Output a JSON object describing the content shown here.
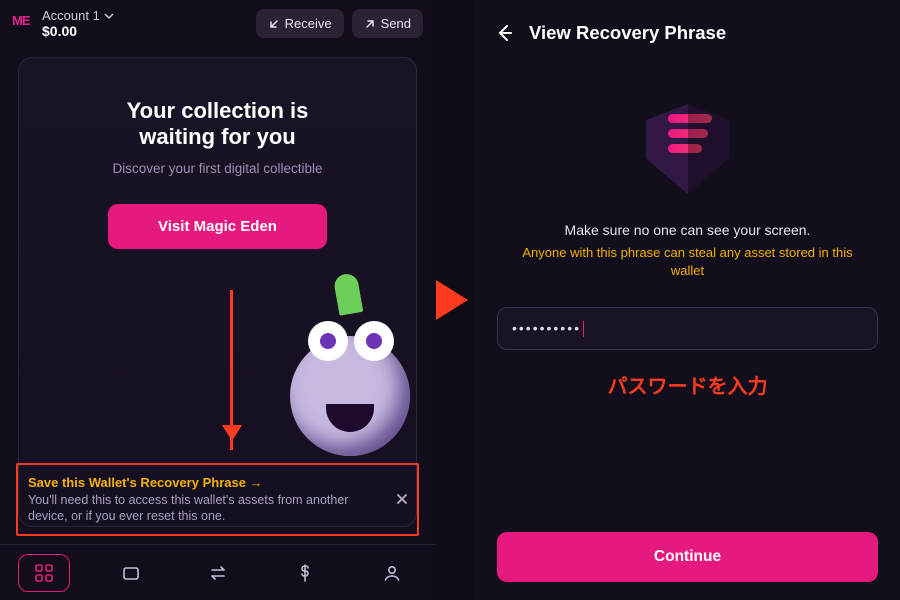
{
  "left": {
    "logo_text": "ME",
    "account_label": "Account 1",
    "balance": "$0.00",
    "receive_label": "Receive",
    "send_label": "Send",
    "hero": {
      "title_line1": "Your collection is",
      "title_line2": "waiting for you",
      "subtitle": "Discover your first digital collectible",
      "cta_label": "Visit Magic Eden"
    },
    "banner": {
      "title": "Save this Wallet's Recovery Phrase →",
      "description": "You'll need this to access this wallet's assets from another device, or if you ever reset this one."
    }
  },
  "right": {
    "title": "View Recovery Phrase",
    "warn_primary": "Make sure no one can see your screen.",
    "warn_secondary": "Anyone with this phrase can steal any asset stored in this wallet",
    "password_mask": "••••••••••",
    "jp_label": "パスワードを入力",
    "continue_label": "Continue"
  }
}
